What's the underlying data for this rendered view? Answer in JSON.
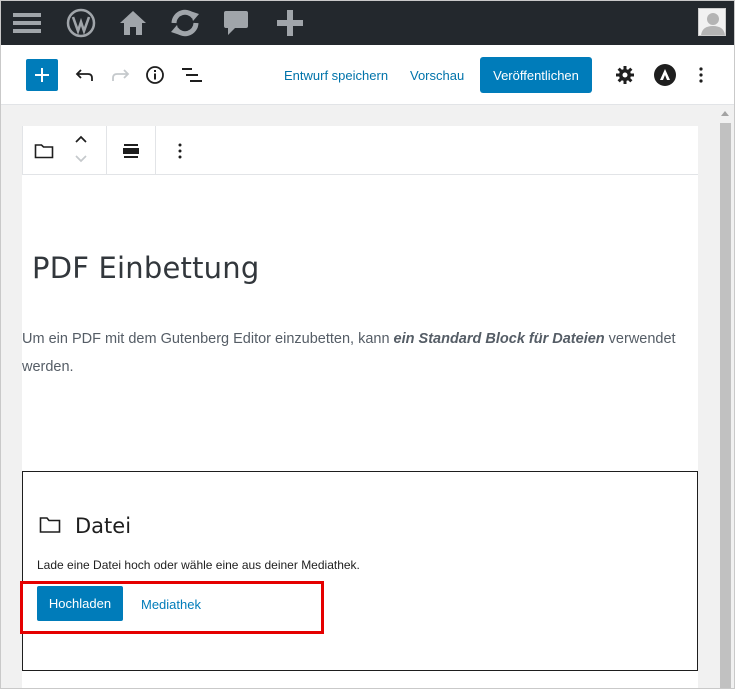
{
  "adminbar": {
    "icons": [
      "menu-icon",
      "wordpress-icon",
      "home-icon",
      "updates-icon",
      "comments-icon",
      "add-new-icon"
    ],
    "avatar": "avatar-icon"
  },
  "header": {
    "save_draft": "Entwurf speichern",
    "preview": "Vorschau",
    "publish": "Veröffentlichen"
  },
  "document": {
    "title": "PDF Einbettung",
    "para_before": "Um ein PDF mit dem Gutenberg Editor einzubetten, kann ",
    "para_emph": "ein Standard Block für Dateien",
    "para_after": " verwendet werden."
  },
  "file_block": {
    "title": "Datei",
    "instructions": "Lade eine Datei hoch oder wähle eine aus deiner Mediathek.",
    "upload_label": "Hochladen",
    "media_label": "Mediathek"
  },
  "colors": {
    "accent": "#007cba",
    "adminbar": "#23282d",
    "highlight": "#e50000"
  }
}
